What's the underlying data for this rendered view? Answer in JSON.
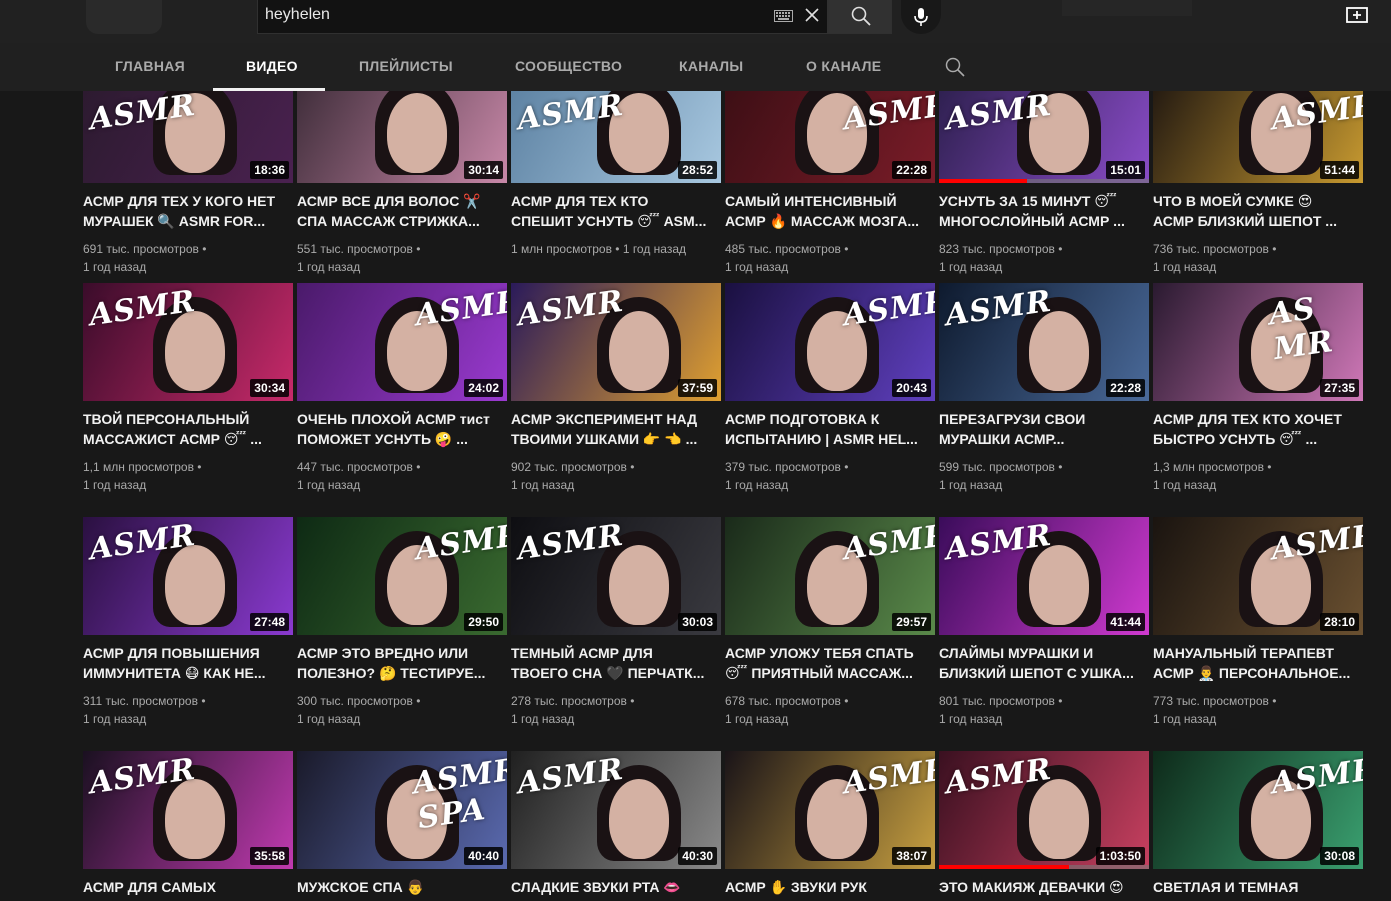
{
  "search": {
    "query": "heyhelen"
  },
  "tabs": [
    {
      "label": "ГЛАВНАЯ"
    },
    {
      "label": "ВИДЕО"
    },
    {
      "label": "ПЛЕЙЛИСТЫ"
    },
    {
      "label": "СООБЩЕСТВО"
    },
    {
      "label": "КАНАЛЫ"
    },
    {
      "label": "О КАНАЛЕ"
    }
  ],
  "videos": [
    {
      "line1": "АСМР ДЛЯ ТЕХ У КОГО НЕТ",
      "line2": "МУРАШЕК 🔍 ASMR FOR...",
      "views": "691 тыс. просмотров •",
      "age": "1 год назад",
      "duration": "18:36",
      "logo": "ASMR",
      "c1": "#2b1a2e",
      "c2": "#4a2150",
      "progress": 0
    },
    {
      "line1": "АСМР ВСЕ ДЛЯ ВОЛОС ✂️",
      "line2": "СПА МАССАЖ СТРИЖКА...",
      "views": "551 тыс. просмотров •",
      "age": "1 год назад",
      "duration": "30:14",
      "logo": "",
      "c1": "#3a2a36",
      "c2": "#c888a8",
      "progress": 0
    },
    {
      "line1": "АСМР ДЛЯ ТЕХ КТО",
      "line2": "СПЕШИТ УСНУТЬ 😴 ASM...",
      "views": "1 млн просмотров • 1 год назад",
      "age": "",
      "duration": "28:52",
      "logo": "ASMR",
      "c1": "#5a7fa0",
      "c2": "#a8c8e0",
      "progress": 0
    },
    {
      "line1": "САМЫЙ ИНТЕНСИВНЫЙ",
      "line2": "АСМР 🔥 МАССАЖ МОЗГА...",
      "views": "485 тыс. просмотров •",
      "age": "1 год назад",
      "duration": "22:28",
      "logo": "ASMR",
      "c1": "#3a0e14",
      "c2": "#7a1c28",
      "progress": 0
    },
    {
      "line1": "УСНУТЬ ЗА 15 МИНУТ 😴",
      "line2": "МНОГОСЛОЙНЫЙ АСМР ...",
      "views": "823 тыс. просмотров •",
      "age": "1 год назад",
      "duration": "15:01",
      "logo": "ASMR",
      "c1": "#2a1e4a",
      "c2": "#8a4cc8",
      "progress": 0.42
    },
    {
      "line1": "ЧТО В МОЕЙ СУМКЕ 😍",
      "line2": "АСМР БЛИЗКИЙ ШЕПОТ ...",
      "views": "736 тыс. просмотров •",
      "age": "1 год назад",
      "duration": "51:44",
      "logo": "ASMR",
      "c1": "#1c1410",
      "c2": "#c89a30",
      "progress": 0
    },
    {
      "line1": "ТВОЙ ПЕРСОНАЛЬНЫЙ",
      "line2": "МАССАЖИСТ АСМР 😴 ...",
      "views": "1,1 млн просмотров •",
      "age": "1 год назад",
      "duration": "30:34",
      "logo": "ASMR",
      "c1": "#3a0c2a",
      "c2": "#c82a6a",
      "progress": 0
    },
    {
      "line1": "ОЧЕНЬ ПЛОХОЙ АСМР тист",
      "line2": "ПОМОЖЕТ УСНУТЬ 🤪 ...",
      "views": "447 тыс. просмотров •",
      "age": "1 год назад",
      "duration": "24:02",
      "logo": "ASMR",
      "c1": "#4a1a6a",
      "c2": "#9a3ad0",
      "progress": 0
    },
    {
      "line1": "АСМР ЭКСПЕРИМЕНТ НАД",
      "line2": "ТВОИМИ УШКАМИ 👉 👈 ...",
      "views": "902 тыс. просмотров •",
      "age": "1 год назад",
      "duration": "37:59",
      "logo": "ASMR",
      "c1": "#2a1a5a",
      "c2": "#e0a030",
      "progress": 0
    },
    {
      "line1": "АСМР ПОДГОТОВКА К",
      "line2": "ИСПЫТАНИЮ | ASMR HEL...",
      "views": "379 тыс. просмотров •",
      "age": "1 год назад",
      "duration": "20:43",
      "logo": "ASMR",
      "c1": "#1a1040",
      "c2": "#6040c0",
      "progress": 0
    },
    {
      "line1": "ПЕРЕЗАГРУЗИ СВОИ",
      "line2": "МУРАШКИ АСМР...",
      "views": "599 тыс. просмотров •",
      "age": "1 год назад",
      "duration": "22:28",
      "logo": "ASMR",
      "c1": "#0e1a2e",
      "c2": "#4a6a9a",
      "progress": 0
    },
    {
      "line1": "АСМР ДЛЯ ТЕХ КТО ХОЧЕТ",
      "line2": "БЫСТРО УСНУТЬ 😴 ...",
      "views": "1,3 млн просмотров •",
      "age": "1 год назад",
      "duration": "27:35",
      "logo": "AS MR",
      "c1": "#2a1a30",
      "c2": "#d078b8",
      "progress": 0
    },
    {
      "line1": "АСМР ДЛЯ ПОВЫШЕНИЯ",
      "line2": "ИММУНИТЕТА 😷 КАК НЕ...",
      "views": "311 тыс. просмотров •",
      "age": "1 год назад",
      "duration": "27:48",
      "logo": "ASMR",
      "c1": "#2a1040",
      "c2": "#8a3ad0",
      "progress": 0
    },
    {
      "line1": "АСМР ЭТО ВРЕДНО ИЛИ",
      "line2": "ПОЛЕЗНО? 🤔 ТЕСТИРУЕ...",
      "views": "300 тыс. просмотров •",
      "age": "1 год назад",
      "duration": "29:50",
      "logo": "ASMR",
      "c1": "#0e2a14",
      "c2": "#3a6a30",
      "progress": 0
    },
    {
      "line1": "ТЕМНЫЙ АСМР ДЛЯ",
      "line2": "ТВОЕГО СНА 🖤 ПЕРЧАТК...",
      "views": "278 тыс. просмотров •",
      "age": "1 год назад",
      "duration": "30:03",
      "logo": "ASMR",
      "c1": "#0e0e12",
      "c2": "#3a3a40",
      "progress": 0
    },
    {
      "line1": "АСМР УЛОЖУ ТЕБЯ СПАТЬ",
      "line2": "😴 ПРИЯТНЫЙ МАССАЖ...",
      "views": "678 тыс. просмотров •",
      "age": "1 год назад",
      "duration": "29:57",
      "logo": "ASMR",
      "c1": "#1a2a1a",
      "c2": "#5a8a4a",
      "progress": 0
    },
    {
      "line1": "СЛАЙМЫ МУРАШКИ И",
      "line2": "БЛИЗКИЙ ШЕПОТ С УШКА...",
      "views": "801 тыс. просмотров •",
      "age": "1 год назад",
      "duration": "41:44",
      "logo": "ASMR",
      "c1": "#3a0c5a",
      "c2": "#d03ad0",
      "progress": 0
    },
    {
      "line1": "МАНУАЛЬНЫЙ ТЕРАПЕВТ",
      "line2": "АСМР 👨‍⚕️ ПЕРСОНАЛЬНОЕ...",
      "views": "773 тыс. просмотров •",
      "age": "1 год назад",
      "duration": "28:10",
      "logo": "ASMR",
      "c1": "#1a1410",
      "c2": "#6a5030",
      "progress": 0
    },
    {
      "line1": "АСМР ДЛЯ САМЫХ",
      "line2": "",
      "views": "",
      "age": "",
      "duration": "35:58",
      "logo": "ASMR",
      "c1": "#1a1020",
      "c2": "#c03ab0",
      "progress": 0
    },
    {
      "line1": "МУЖСКОЕ СПА 👨",
      "line2": "",
      "views": "",
      "age": "",
      "duration": "40:40",
      "logo": "ASMR SPA",
      "c1": "#1a1a2a",
      "c2": "#5a6ab0",
      "progress": 0
    },
    {
      "line1": "СЛАДКИЕ ЗВУКИ РТА 👄",
      "line2": "",
      "views": "",
      "age": "",
      "duration": "40:30",
      "logo": "ASMR",
      "c1": "#202020",
      "c2": "#8a8a8a",
      "progress": 0
    },
    {
      "line1": "АСМР ✋ ЗВУКИ РУК",
      "line2": "",
      "views": "",
      "age": "",
      "duration": "38:07",
      "logo": "ASMR",
      "c1": "#1a1418",
      "c2": "#c8a040",
      "progress": 0
    },
    {
      "line1": "ЭТО МАКИЯЖ ДЕВАЧКИ 😍",
      "line2": "",
      "views": "",
      "age": "",
      "duration": "1:03:50",
      "logo": "ASMR",
      "c1": "#3a1020",
      "c2": "#c84060",
      "progress": 0.62
    },
    {
      "line1": "СВЕТЛАЯ И ТЕМНАЯ",
      "line2": "",
      "views": "",
      "age": "",
      "duration": "30:08",
      "logo": "ASMR",
      "c1": "#0e2a1a",
      "c2": "#3aa070",
      "progress": 0
    }
  ]
}
